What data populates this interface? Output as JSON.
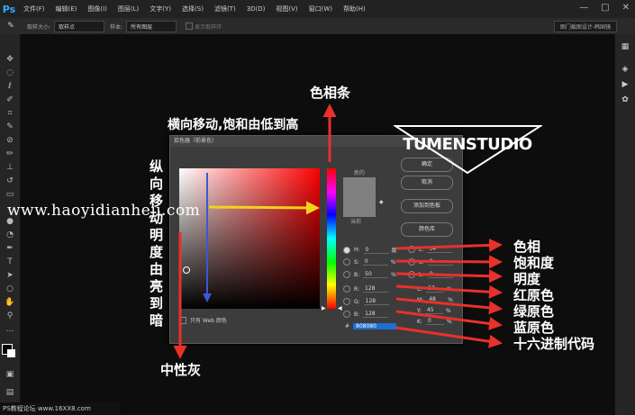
{
  "app": {
    "logo": "Ps"
  },
  "menu": [
    "文件(F)",
    "编辑(E)",
    "图像(I)",
    "图层(L)",
    "文字(Y)",
    "选择(S)",
    "滤镜(T)",
    "3D(D)",
    "视图(V)",
    "窗口(W)",
    "帮助(H)"
  ],
  "window_controls": [
    "—",
    "□",
    "✕"
  ],
  "options": {
    "sample_size_label": "取样大小:",
    "sample_size_value": "取样点",
    "sample_label": "样本:",
    "sample_value": "所有图层",
    "show_ring_label": "显示取样环",
    "workspace": "图门截图设计-韩国镜"
  },
  "dialog": {
    "title": "拾色器（前景色）",
    "new_label": "新的",
    "current_label": "当前",
    "buttons": {
      "ok": "确定",
      "cancel": "取消",
      "add_swatch": "添加到色板",
      "color_libraries": "颜色库"
    },
    "web_only": "只有 Web 颜色",
    "fields": {
      "H": {
        "label": "H:",
        "value": "0",
        "unit": "度"
      },
      "S": {
        "label": "S:",
        "value": "0",
        "unit": "%"
      },
      "B": {
        "label": "B:",
        "value": "50",
        "unit": "%"
      },
      "R": {
        "label": "R:",
        "value": "128"
      },
      "G": {
        "label": "G:",
        "value": "128"
      },
      "Bl": {
        "label": "B:",
        "value": "128"
      },
      "L": {
        "label": "L:",
        "value": "54"
      },
      "a": {
        "label": "a:",
        "value": "0"
      },
      "b": {
        "label": "b:",
        "value": "0"
      },
      "C": {
        "label": "C:",
        "value": "57",
        "unit": "%"
      },
      "M": {
        "label": "M:",
        "value": "48",
        "unit": "%"
      },
      "Y": {
        "label": "Y:",
        "value": "45",
        "unit": "%"
      },
      "K": {
        "label": "K:",
        "value": "0",
        "unit": "%"
      }
    },
    "hex_prefix": "#",
    "hex_value": "808080",
    "colors": {
      "current": "#808080",
      "hex_highlight": "#1e6fd1"
    }
  },
  "annotations": {
    "hue_strip": "色相条",
    "horizontal": "横向移动,饱和由低到高",
    "vertical": "纵向移动明度由亮到暗",
    "neutral_gray": "中性灰",
    "hue": "色相",
    "saturation": "饱和度",
    "brightness": "明度",
    "red": "红原色",
    "green": "绿原色",
    "blue": "蓝原色",
    "hex": "十六进制代码"
  },
  "logo_text": "TUMENSTUDIO",
  "watermark": "www.haoyidianheji.com",
  "footer": "PS教程论坛 www.16XX8.com",
  "arrow_colors": {
    "red": "#e8312a",
    "blue": "#3a57d6",
    "yellow": "#f2d21b"
  }
}
